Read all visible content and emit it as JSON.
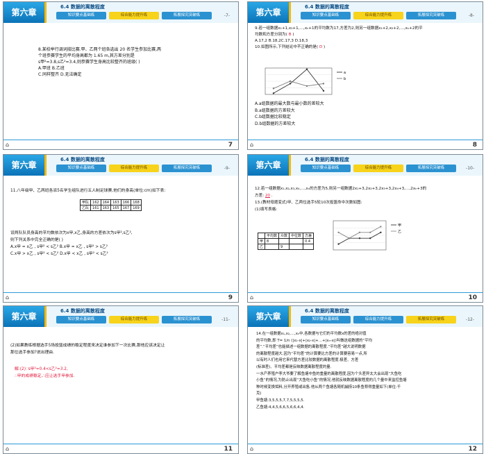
{
  "header": {
    "chapter": "第六章",
    "section_title": "6.4  数据的离散程度",
    "tabs": [
      "知识要点基础练",
      "综合能力提升练",
      "拓展探究突破练"
    ]
  },
  "slides": [
    {
      "number": "7",
      "page_label": "-7-",
      "active_tab": 1,
      "lines": [
        "8.某校举行调词接比赛.甲、乙两个班各选出 20 名学生参加比赛,两",
        "个班参赛学生的平均身高都为 1.65 m,其方差分别是",
        "s甲²=3.8,s乙²=3.4,则参赛学生身高比较整齐的班级(    )",
        "A.甲班                         B.乙班",
        "C.同样整齐                   D.无法确定"
      ]
    },
    {
      "number": "8",
      "page_label": "-8-",
      "active_tab": 1,
      "lines": [
        "9.若一组数据x₁+1,x₂+1,…,xₙ+1的平均数为17,方差为2,则另一组数据x₁+2,x₂+2,…,xₙ+2的平",
        "均数和方差分别为(  B  )",
        "A.17,2   B.18,2C.17,3       D.18,3",
        "10.如图所示,下列结论中不正确的是(  D  )"
      ],
      "answer_9": "B",
      "answer_10": "D",
      "options": [
        "A.a组数据的最大数与最小数的差较大",
        "B.a组数据的方差较大",
        "C.b组数据比较稳定",
        "D.b组数据的方差较大"
      ],
      "chart_data": {
        "type": "line",
        "title": "",
        "xlabel": "",
        "ylabel": "",
        "series": [
          {
            "name": "a",
            "values": [
              10,
              18,
              30,
              12
            ]
          },
          {
            "name": "b",
            "values": [
              14,
              20,
              16,
              18
            ]
          }
        ]
      }
    },
    {
      "number": "9",
      "page_label": "-9-",
      "active_tab": 1,
      "lines": [
        "11.八年级甲、乙两班各派5名学生组队进行五人制足球赛,他们的身高(单位:cm)如下表:",
        "设两队队员身高的平均数依次为x甲,x乙,身高的方差依次为s甲²,s乙²,",
        "则下列关系中完全正确的是(      )",
        "A.x甲 = x乙 , s甲² < s乙²                B.x甲 = x乙 , s甲² > s乙²",
        "C.x甲 > x乙 , s甲² < s乙²                D.x甲 < x乙 , s甲² < s乙²"
      ],
      "table": [
        [
          "甲队",
          "162",
          "164",
          "163",
          "166",
          "168"
        ],
        [
          "乙队",
          "161",
          "163",
          "165",
          "167",
          "169"
        ]
      ]
    },
    {
      "number": "10",
      "page_label": "-10-",
      "active_tab": 1,
      "lines": [
        "12.若一组数据x₁,x₂,x₃,x₄,…,xₙ的方差为5,则另一组数据2x₁+3,2x₂+3,2x₃+3,2x₄+3,…,2xₙ+3的",
        "方差:   20   .",
        "13.(教材母题变式)甲、乙两位选手5轮10次投篮命中次数如图:",
        "(1)填写表格:"
      ],
      "answer_12": "20",
      "table": [
        [
          "",
          "平均数",
          "众数",
          "中位数",
          "方差"
        ],
        [
          "甲",
          "8",
          "",
          "",
          "0.4"
        ],
        [
          "乙",
          "",
          "9",
          "",
          ""
        ]
      ],
      "chart_data": {
        "type": "line",
        "title": "",
        "xlabel": "",
        "ylabel": "",
        "series": [
          {
            "name": "甲",
            "values": [
              7,
              8,
              8,
              8,
              9
            ]
          },
          {
            "name": "乙",
            "values": [
              9,
              8,
              9,
              9,
              10
            ]
          }
        ]
      }
    },
    {
      "number": "11",
      "page_label": "-11-",
      "active_tab": 1,
      "lines": [
        "(2)如果教练根据选手5场投篮成绩的稳定程度来决定谁参加下一次比赛,那他应该决定让",
        "那位选手参加?说出理由."
      ],
      "answer_lines": [
        "解:(2)∵s甲²=0.4<s乙²=3.2,",
        "∴甲的成绩稳定,∴应让选手甲参加."
      ]
    },
    {
      "number": "12",
      "page_label": "-12-",
      "active_tab": 2,
      "lines": [
        "14.在一组数据x₁,x₂,…,xₙ中,各数据与它们的平均数x的差的绝对值",
        "的平均数,即 T= 1/n (|x₁-x|+|x₂-x|+…+|xₙ-x|)叫做这组数据的“平均",
        "差”.“平均差”也能描述一组数据的离散程度.“平均差”越大说明数据",
        "的离散程度越大.因为“平均差”的计算要比方差的计算要容易一点,所",
        "以有时人们也用它来代替方差比较数据的离散程度.极差、方差",
        "(标准差)、平均差都是反映数据离散程度的量.",
        "一水产养殖户李大爷要了解鱼塘中鱼的重量的离散程度,因为个头差异太大会出现“大鱼吃",
        "小鱼”的情况,为防止出现“大鱼吃小鱼”的情况,他就反映数据离散程度的几个量中来监控鱼塘",
        "种时候变换饵料,分开养殖或出售.他从两个鱼塘各随机捕捞10条鱼称得重量如下(单位:千",
        "克)",
        "甲鱼塘:3,5,5,5,7,7,5,5,5,5.",
        "乙鱼塘:4,4,5,6,6,5,6,6,4,4."
      ]
    }
  ]
}
